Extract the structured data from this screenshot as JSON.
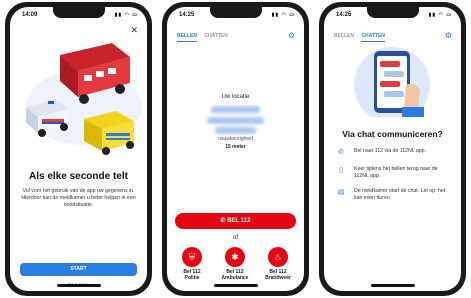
{
  "colors": {
    "accent": "#2a7de1",
    "emergency": "#e30613"
  },
  "phone1": {
    "time": "14:09",
    "title": "Als elke seconde telt",
    "body": "Vul voor het gebruik van de app uw gegevens in. Hierdoor kan de meldkamer u beter helpen in een noodsituatie.",
    "start_label": "START"
  },
  "phone2": {
    "time": "14:25",
    "tabs": [
      "BELLEN",
      "CHATTEN"
    ],
    "location_label": "Uw locatie",
    "accuracy_label": "nauwkeurigheid",
    "accuracy_value": "15 meter",
    "call_label": "BEL 112",
    "or_label": "of",
    "services": [
      {
        "line1": "Bel 112",
        "line2": "Politie",
        "icon": "police-icon"
      },
      {
        "line1": "Bel 112",
        "line2": "Ambulance",
        "icon": "ambulance-icon"
      },
      {
        "line1": "Bel 112",
        "line2": "Brandweer",
        "icon": "fire-icon"
      }
    ]
  },
  "phone3": {
    "time": "14:25",
    "tabs": [
      "BELLEN",
      "CHATTEN"
    ],
    "title": "Via chat communiceren?",
    "steps": [
      {
        "icon": "phone-icon",
        "text": "Bel naar 112 via de 112NL app."
      },
      {
        "icon": "mobile-icon",
        "text": "Keer tijdens het bellen terug naar de 112NL app."
      },
      {
        "icon": "chat-icon",
        "text": "De meldkamer start de chat. Let op: het kan even duren."
      }
    ]
  }
}
